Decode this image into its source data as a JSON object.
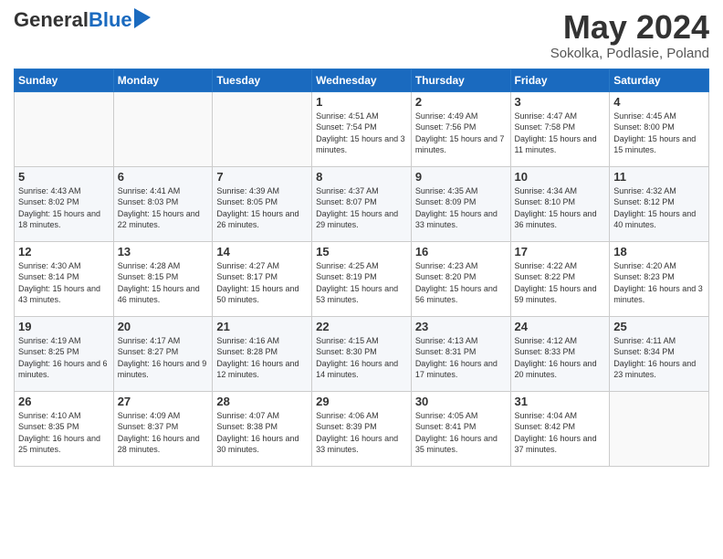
{
  "logo": {
    "general": "General",
    "blue": "Blue"
  },
  "title": "May 2024",
  "subtitle": "Sokolka, Podlasie, Poland",
  "weekdays": [
    "Sunday",
    "Monday",
    "Tuesday",
    "Wednesday",
    "Thursday",
    "Friday",
    "Saturday"
  ],
  "weeks": [
    [
      {
        "day": "",
        "text": ""
      },
      {
        "day": "",
        "text": ""
      },
      {
        "day": "",
        "text": ""
      },
      {
        "day": "1",
        "text": "Sunrise: 4:51 AM\nSunset: 7:54 PM\nDaylight: 15 hours and 3 minutes."
      },
      {
        "day": "2",
        "text": "Sunrise: 4:49 AM\nSunset: 7:56 PM\nDaylight: 15 hours and 7 minutes."
      },
      {
        "day": "3",
        "text": "Sunrise: 4:47 AM\nSunset: 7:58 PM\nDaylight: 15 hours and 11 minutes."
      },
      {
        "day": "4",
        "text": "Sunrise: 4:45 AM\nSunset: 8:00 PM\nDaylight: 15 hours and 15 minutes."
      }
    ],
    [
      {
        "day": "5",
        "text": "Sunrise: 4:43 AM\nSunset: 8:02 PM\nDaylight: 15 hours and 18 minutes."
      },
      {
        "day": "6",
        "text": "Sunrise: 4:41 AM\nSunset: 8:03 PM\nDaylight: 15 hours and 22 minutes."
      },
      {
        "day": "7",
        "text": "Sunrise: 4:39 AM\nSunset: 8:05 PM\nDaylight: 15 hours and 26 minutes."
      },
      {
        "day": "8",
        "text": "Sunrise: 4:37 AM\nSunset: 8:07 PM\nDaylight: 15 hours and 29 minutes."
      },
      {
        "day": "9",
        "text": "Sunrise: 4:35 AM\nSunset: 8:09 PM\nDaylight: 15 hours and 33 minutes."
      },
      {
        "day": "10",
        "text": "Sunrise: 4:34 AM\nSunset: 8:10 PM\nDaylight: 15 hours and 36 minutes."
      },
      {
        "day": "11",
        "text": "Sunrise: 4:32 AM\nSunset: 8:12 PM\nDaylight: 15 hours and 40 minutes."
      }
    ],
    [
      {
        "day": "12",
        "text": "Sunrise: 4:30 AM\nSunset: 8:14 PM\nDaylight: 15 hours and 43 minutes."
      },
      {
        "day": "13",
        "text": "Sunrise: 4:28 AM\nSunset: 8:15 PM\nDaylight: 15 hours and 46 minutes."
      },
      {
        "day": "14",
        "text": "Sunrise: 4:27 AM\nSunset: 8:17 PM\nDaylight: 15 hours and 50 minutes."
      },
      {
        "day": "15",
        "text": "Sunrise: 4:25 AM\nSunset: 8:19 PM\nDaylight: 15 hours and 53 minutes."
      },
      {
        "day": "16",
        "text": "Sunrise: 4:23 AM\nSunset: 8:20 PM\nDaylight: 15 hours and 56 minutes."
      },
      {
        "day": "17",
        "text": "Sunrise: 4:22 AM\nSunset: 8:22 PM\nDaylight: 15 hours and 59 minutes."
      },
      {
        "day": "18",
        "text": "Sunrise: 4:20 AM\nSunset: 8:23 PM\nDaylight: 16 hours and 3 minutes."
      }
    ],
    [
      {
        "day": "19",
        "text": "Sunrise: 4:19 AM\nSunset: 8:25 PM\nDaylight: 16 hours and 6 minutes."
      },
      {
        "day": "20",
        "text": "Sunrise: 4:17 AM\nSunset: 8:27 PM\nDaylight: 16 hours and 9 minutes."
      },
      {
        "day": "21",
        "text": "Sunrise: 4:16 AM\nSunset: 8:28 PM\nDaylight: 16 hours and 12 minutes."
      },
      {
        "day": "22",
        "text": "Sunrise: 4:15 AM\nSunset: 8:30 PM\nDaylight: 16 hours and 14 minutes."
      },
      {
        "day": "23",
        "text": "Sunrise: 4:13 AM\nSunset: 8:31 PM\nDaylight: 16 hours and 17 minutes."
      },
      {
        "day": "24",
        "text": "Sunrise: 4:12 AM\nSunset: 8:33 PM\nDaylight: 16 hours and 20 minutes."
      },
      {
        "day": "25",
        "text": "Sunrise: 4:11 AM\nSunset: 8:34 PM\nDaylight: 16 hours and 23 minutes."
      }
    ],
    [
      {
        "day": "26",
        "text": "Sunrise: 4:10 AM\nSunset: 8:35 PM\nDaylight: 16 hours and 25 minutes."
      },
      {
        "day": "27",
        "text": "Sunrise: 4:09 AM\nSunset: 8:37 PM\nDaylight: 16 hours and 28 minutes."
      },
      {
        "day": "28",
        "text": "Sunrise: 4:07 AM\nSunset: 8:38 PM\nDaylight: 16 hours and 30 minutes."
      },
      {
        "day": "29",
        "text": "Sunrise: 4:06 AM\nSunset: 8:39 PM\nDaylight: 16 hours and 33 minutes."
      },
      {
        "day": "30",
        "text": "Sunrise: 4:05 AM\nSunset: 8:41 PM\nDaylight: 16 hours and 35 minutes."
      },
      {
        "day": "31",
        "text": "Sunrise: 4:04 AM\nSunset: 8:42 PM\nDaylight: 16 hours and 37 minutes."
      },
      {
        "day": "",
        "text": ""
      }
    ]
  ]
}
